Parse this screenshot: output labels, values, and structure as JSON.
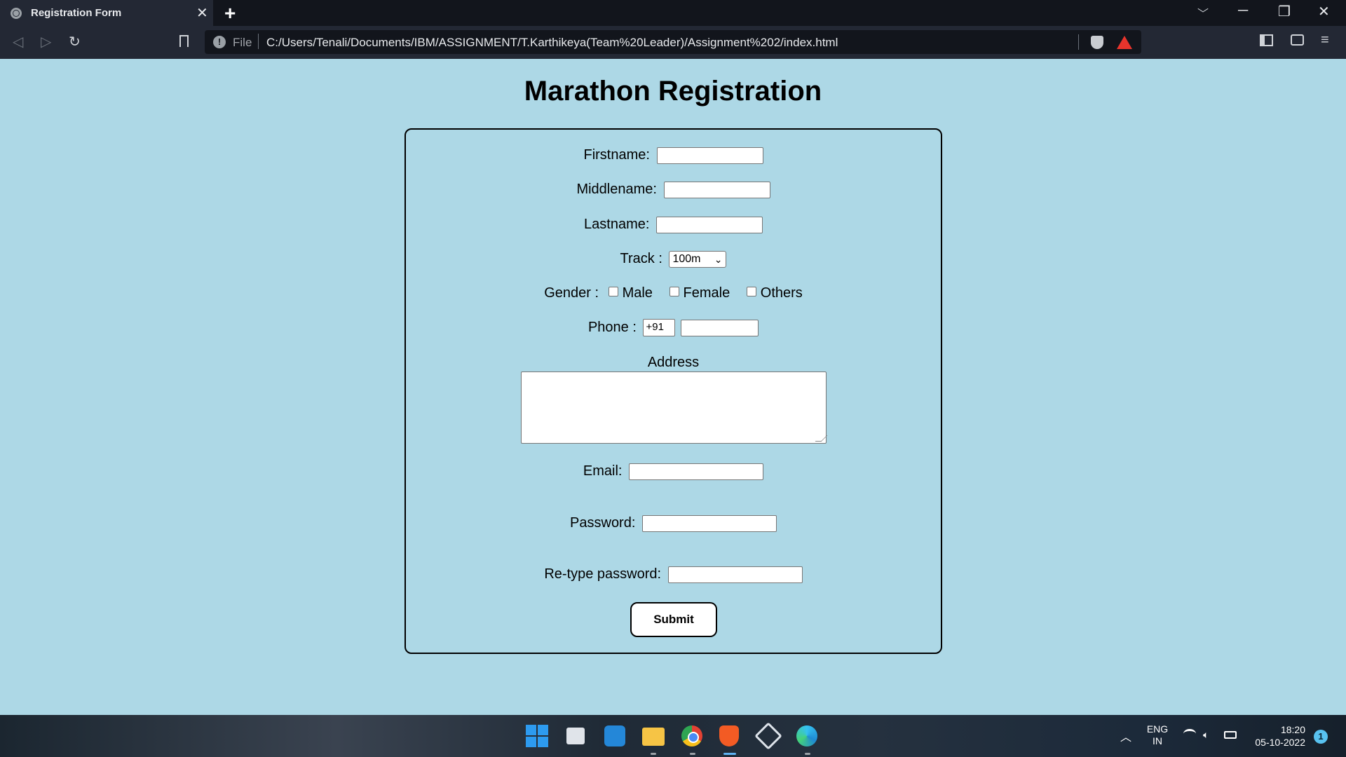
{
  "browser": {
    "tab_title": "Registration Form",
    "tab_close": "✕",
    "new_tab": "+",
    "scheme_label": "File",
    "url": "C:/Users/Tenali/Documents/IBM/ASSIGNMENT/T.Karthikeya(Team%20Leader)/Assignment%202/index.html",
    "window_controls": {
      "minimize": "─",
      "restore": "❐",
      "close": "✕"
    },
    "nav": {
      "back": "◁",
      "forward": "▷",
      "reload": "↻"
    },
    "menu": "≡"
  },
  "page": {
    "title": "Marathon Registration"
  },
  "form": {
    "firstname_label": "Firstname:",
    "middlename_label": "Middlename:",
    "lastname_label": "Lastname:",
    "track_label": "Track :",
    "track_selected": "100m",
    "gender_label": "Gender :",
    "gender_options": [
      "Male",
      "Female",
      "Others"
    ],
    "phone_label": "Phone :",
    "phone_code": "+91",
    "address_label": "Address",
    "email_label": "Email:",
    "password_label": "Password:",
    "retype_label": "Re-type password:",
    "submit_label": "Submit"
  },
  "taskbar": {
    "language": "ENG",
    "region": "IN",
    "time": "18:20",
    "date": "05-10-2022",
    "notification_count": "1"
  },
  "icons": {
    "favicon": "globe-icon",
    "info": "info-icon",
    "shield": "brave-shield-icon",
    "rewards": "brave-rewards-icon",
    "colors": {
      "page_bg": "#add8e6",
      "chrome_bg": "#232834",
      "tabbar_bg": "#12151c"
    }
  }
}
